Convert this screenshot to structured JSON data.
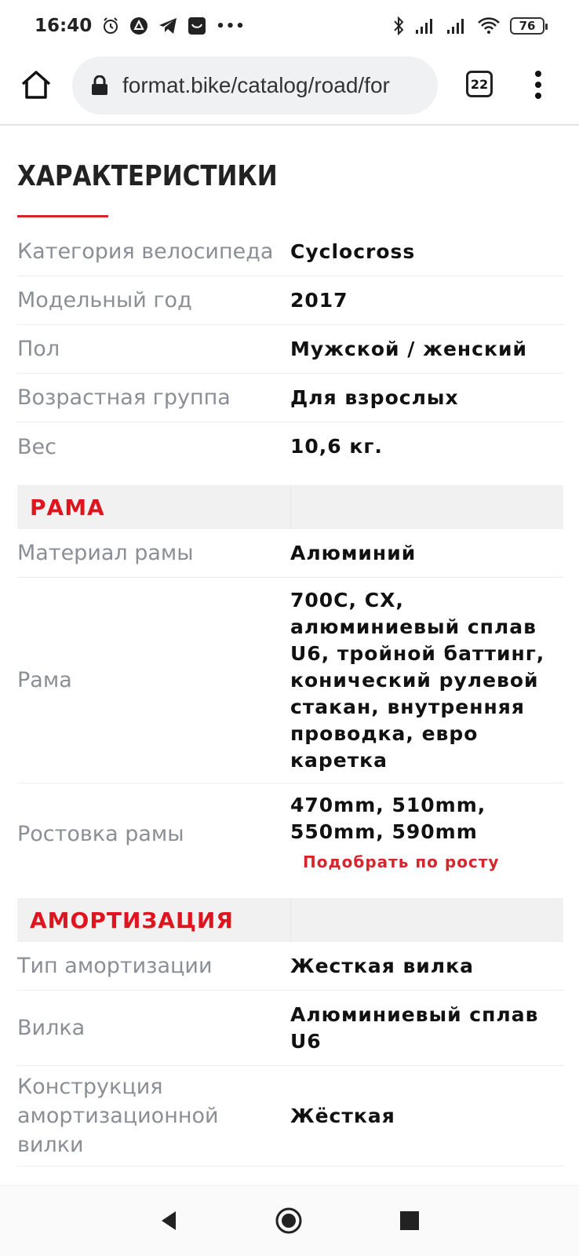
{
  "status_bar": {
    "time": "16:40",
    "more": "•••",
    "battery": "76"
  },
  "browser": {
    "url": "format.bike/catalog/road/for",
    "tab_count": "22"
  },
  "page": {
    "title": "ХАРАКТЕРИСТИКИ",
    "accent_color": "#d4262b"
  },
  "specs": {
    "general": [
      {
        "label": "Категория велосипеда",
        "value": "Cyclocross"
      },
      {
        "label": "Модельный год",
        "value": "2017"
      },
      {
        "label": "Пол",
        "value": "Мужской / женский"
      },
      {
        "label": "Возрастная группа",
        "value": "Для взрослых"
      },
      {
        "label": "Вес",
        "value": "10,6 кг."
      }
    ],
    "frame_section": {
      "title": "РАМА",
      "rows": [
        {
          "label": "Материал рамы",
          "value": "Алюминий"
        },
        {
          "label": "Рама",
          "value": "700С, CX, алюминиевый сплав U6, тройной баттинг, конический рулевой стакан, внутренняя проводка, евро каретка"
        },
        {
          "label": "Ростовка рамы",
          "value": "470mm, 510mm, 550mm, 590mm",
          "link": "Подобрать по росту"
        }
      ]
    },
    "suspension_section": {
      "title": "АМОРТИЗАЦИЯ",
      "rows": [
        {
          "label": "Тип амортизации",
          "value": "Жесткая вилка"
        },
        {
          "label": "Вилка",
          "value": "Алюминиевый сплав U6"
        },
        {
          "label": "Конструкция амортизационной вилки",
          "value": "Жёсткая"
        }
      ]
    }
  }
}
